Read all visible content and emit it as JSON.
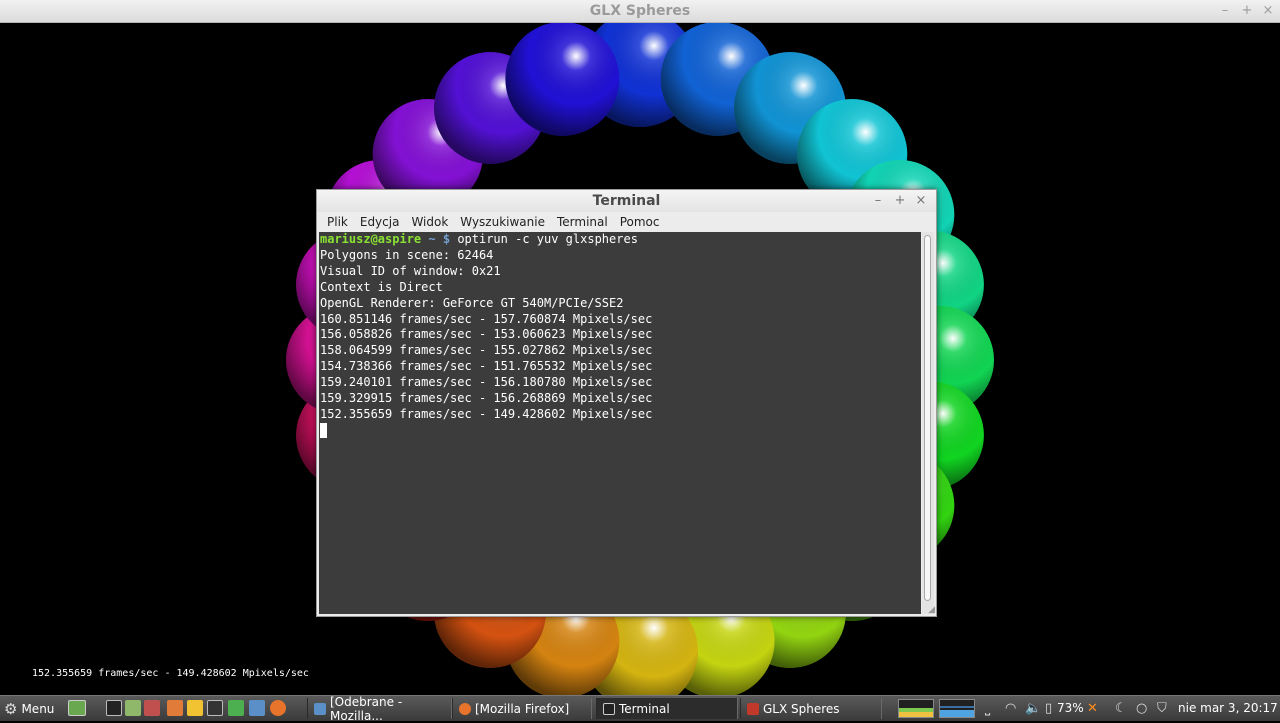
{
  "glx_window": {
    "title": "GLX Spheres",
    "fps_overlay": "152.355659 frames/sec - 149.428602 Mpixels/sec"
  },
  "terminal": {
    "title": "Terminal",
    "menu": [
      "Plik",
      "Edycja",
      "Widok",
      "Wyszukiwanie",
      "Terminal",
      "Pomoc"
    ],
    "prompt_user": "mariusz@aspire",
    "prompt_path": "~ $",
    "command": "optirun -c yuv glxspheres",
    "output": [
      "Polygons in scene: 62464",
      "Visual ID of window: 0x21",
      "Context is Direct",
      "OpenGL Renderer: GeForce GT 540M/PCIe/SSE2",
      "160.851146 frames/sec - 157.760874 Mpixels/sec",
      "156.058826 frames/sec - 153.060623 Mpixels/sec",
      "158.064599 frames/sec - 155.027862 Mpixels/sec",
      "154.738366 frames/sec - 151.765532 Mpixels/sec",
      "159.240101 frames/sec - 156.180780 Mpixels/sec",
      "159.329915 frames/sec - 156.268869 Mpixels/sec",
      "152.355659 frames/sec - 149.428602 Mpixels/sec"
    ]
  },
  "taskbar": {
    "menu_label": "Menu",
    "tasks": [
      "[Odebrane - Mozilla...",
      "[Mozilla Firefox]",
      "Terminal",
      "GLX Spheres"
    ],
    "active_task": "Terminal",
    "battery": "73%",
    "clock": "nie mar  3, 20:17"
  }
}
